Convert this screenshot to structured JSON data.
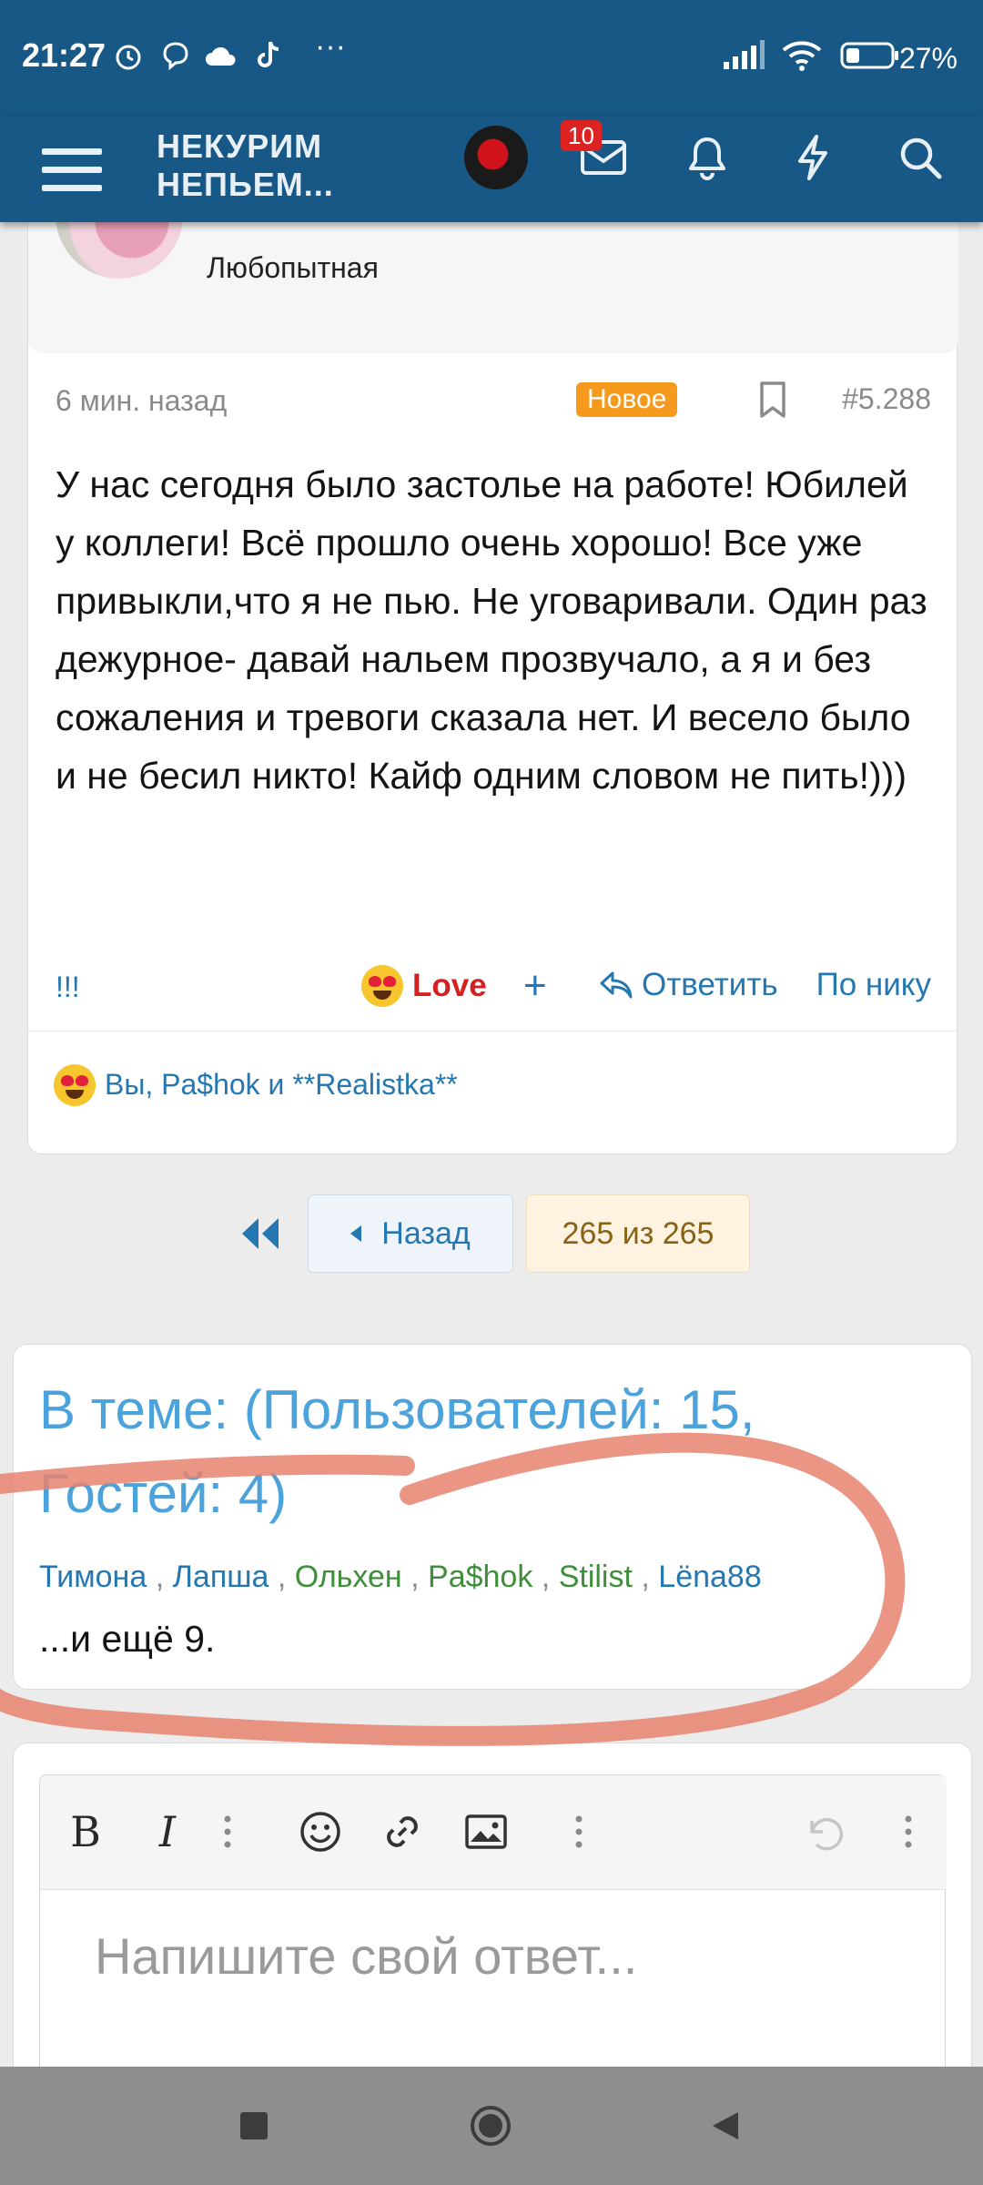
{
  "status_bar": {
    "time": "21:27",
    "more": "···",
    "battery": "27%"
  },
  "header": {
    "site_logo_line1": "НЕКУРИМ",
    "site_logo_line2": "НЕПЬЕМ...",
    "inbox_badge": "10"
  },
  "post": {
    "user_title": "Любопытная",
    "time": "6 мин. назад",
    "new_badge": "Новое",
    "number": "#5.288",
    "body": "У нас сегодня было застолье на работе! Юбилей у коллеги! Всё прошло очень хорошо! Все уже привыкли,что я не пью. Не уговаривали. Один раз дежурное- давай нальем прозвучало, а я и без сожаления и тревоги сказала нет. И весело было и не бесил никто! Кайф одним словом не пить!)))",
    "action_excl": "!!!",
    "action_love": "Love",
    "action_plus": "+",
    "action_reply": "Ответить",
    "action_quote": "По нику",
    "reactions": "Вы, Pa$hok и **Realistka**"
  },
  "pagination": {
    "back": "Назад",
    "count": "265 из 265"
  },
  "online": {
    "title": "В теме: (Пользователей: 15, Гостей: 4)",
    "users": [
      "Тимона",
      "Лапша",
      "Ольхен",
      "Pa$hok",
      "Stilist",
      "Lëna88"
    ],
    "more": "...и ещё 9."
  },
  "editor": {
    "placeholder": "Напишите свой ответ..."
  },
  "colors": {
    "header": "#185886",
    "link": "#2577b1",
    "new_badge": "#f59a1c",
    "annotation": "#e8826f"
  }
}
